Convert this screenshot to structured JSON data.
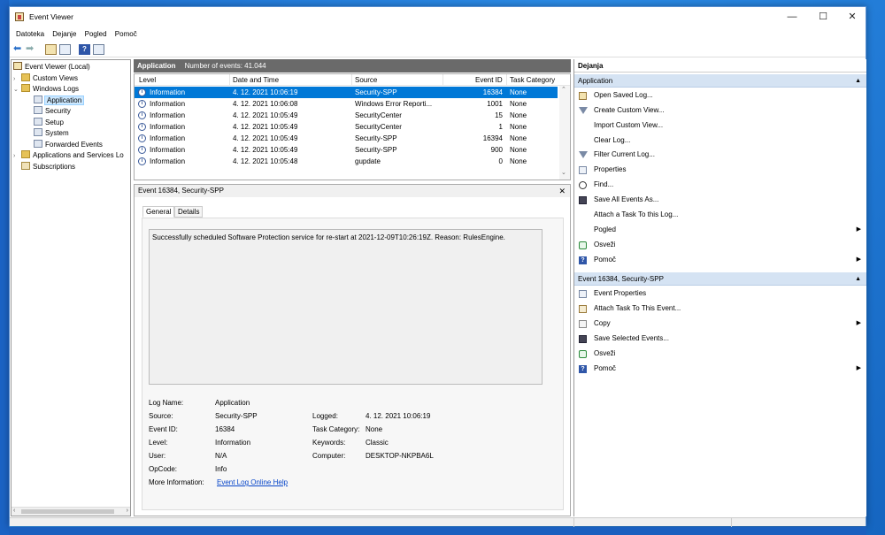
{
  "window": {
    "title": "Event Viewer"
  },
  "menu": [
    "Datoteka",
    "Dejanje",
    "Pogled",
    "Pomoč"
  ],
  "tree": {
    "items": [
      {
        "label": "Event Viewer (Local)"
      },
      {
        "label": "Custom Views"
      },
      {
        "label": "Windows Logs"
      },
      {
        "label": "Application"
      },
      {
        "label": "Security"
      },
      {
        "label": "Setup"
      },
      {
        "label": "System"
      },
      {
        "label": "Forwarded Events"
      },
      {
        "label": "Applications and Services Lo"
      },
      {
        "label": "Subscriptions"
      }
    ]
  },
  "list": {
    "name": "Application",
    "count_label": "Number of events: 41.044",
    "columns": [
      "Level",
      "Date and Time",
      "Source",
      "Event ID",
      "Task Category"
    ],
    "rows": [
      {
        "level": "Information",
        "date": "4. 12. 2021 10:06:19",
        "source": "Security-SPP",
        "id": "16384",
        "cat": "None"
      },
      {
        "level": "Information",
        "date": "4. 12. 2021 10:06:08",
        "source": "Windows Error Reporti...",
        "id": "1001",
        "cat": "None"
      },
      {
        "level": "Information",
        "date": "4. 12. 2021 10:05:49",
        "source": "SecurityCenter",
        "id": "15",
        "cat": "None"
      },
      {
        "level": "Information",
        "date": "4. 12. 2021 10:05:49",
        "source": "SecurityCenter",
        "id": "1",
        "cat": "None"
      },
      {
        "level": "Information",
        "date": "4. 12. 2021 10:05:49",
        "source": "Security-SPP",
        "id": "16394",
        "cat": "None"
      },
      {
        "level": "Information",
        "date": "4. 12. 2021 10:05:49",
        "source": "Security-SPP",
        "id": "900",
        "cat": "None"
      },
      {
        "level": "Information",
        "date": "4. 12. 2021 10:05:48",
        "source": "gupdate",
        "id": "0",
        "cat": "None"
      }
    ]
  },
  "detail": {
    "title": "Event 16384, Security-SPP",
    "tabs": [
      "General",
      "Details"
    ],
    "message": "Successfully scheduled Software Protection service for re-start at 2021-12-09T10:26:19Z. Reason: RulesEngine.",
    "props": {
      "log_name_label": "Log Name:",
      "log_name": "Application",
      "source_label": "Source:",
      "source": "Security-SPP",
      "logged_label": "Logged:",
      "logged": "4. 12. 2021 10:06:19",
      "event_id_label": "Event ID:",
      "event_id": "16384",
      "task_cat_label": "Task Category:",
      "task_cat": "None",
      "level_label": "Level:",
      "level": "Information",
      "keywords_label": "Keywords:",
      "keywords": "Classic",
      "user_label": "User:",
      "user": "N/A",
      "computer_label": "Computer:",
      "computer": "DESKTOP-NKPBA6L",
      "opcode_label": "OpCode:",
      "opcode": "Info",
      "more_info_label": "More Information:",
      "more_info_link": "Event Log Online Help"
    }
  },
  "actions": {
    "title": "Dejanja",
    "section1": {
      "title": "Application",
      "items": [
        {
          "label": "Open Saved Log...",
          "icon": "folder-open-icon"
        },
        {
          "label": "Create Custom View...",
          "icon": "filter-icon"
        },
        {
          "label": "Import Custom View...",
          "icon": "import-icon"
        },
        {
          "label": "Clear Log...",
          "icon": "clear-icon"
        },
        {
          "label": "Filter Current Log...",
          "icon": "filter-icon"
        },
        {
          "label": "Properties",
          "icon": "properties-icon"
        },
        {
          "label": "Find...",
          "icon": "find-icon"
        },
        {
          "label": "Save All Events As...",
          "icon": "save-icon"
        },
        {
          "label": "Attach a Task To this Log...",
          "icon": "task-icon"
        },
        {
          "label": "Pogled",
          "icon": "none",
          "submenu": true
        },
        {
          "label": "Osveži",
          "icon": "refresh-icon"
        },
        {
          "label": "Pomoč",
          "icon": "help-icon",
          "submenu": true
        }
      ]
    },
    "section2": {
      "title": "Event 16384, Security-SPP",
      "items": [
        {
          "label": "Event Properties",
          "icon": "properties-icon"
        },
        {
          "label": "Attach Task To This Event...",
          "icon": "task-icon"
        },
        {
          "label": "Copy",
          "icon": "copy-icon",
          "submenu": true
        },
        {
          "label": "Save Selected Events...",
          "icon": "save-icon"
        },
        {
          "label": "Osveži",
          "icon": "refresh-icon"
        },
        {
          "label": "Pomoč",
          "icon": "help-icon",
          "submenu": true
        }
      ]
    }
  }
}
